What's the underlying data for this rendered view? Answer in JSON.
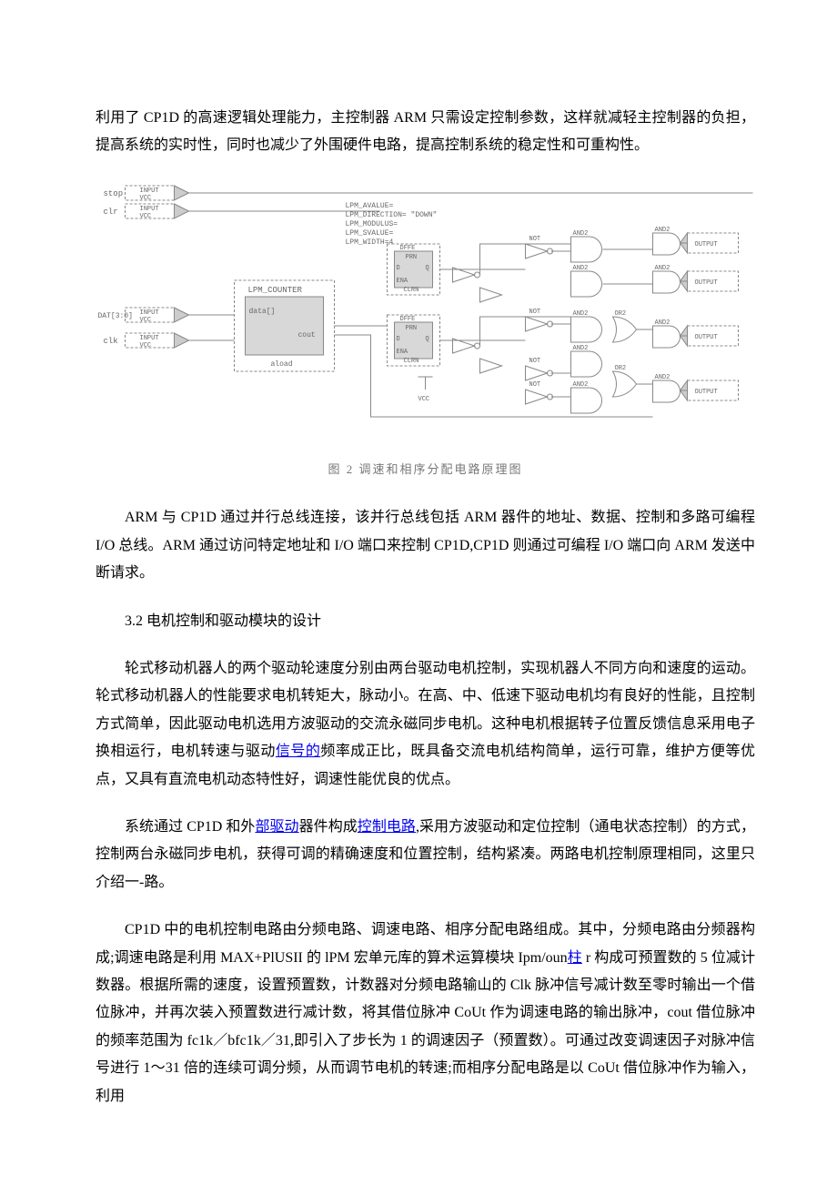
{
  "para1": "利用了 CP1D 的高速逻辑处理能力，主控制器 ARM 只需设定控制参数，这样就减轻主控制器的负担，提高系统的实时性，同时也减少了外围硬件电路，提高控制系统的稳定性和可重构性。",
  "figure": {
    "caption": "图 2  调速和相序分配电路原理图",
    "labels": {
      "stop": "stop",
      "clr": "clr",
      "data": "DAT[3:0]",
      "clk": "clk",
      "input": "INPUT",
      "vcc": "VCC",
      "lpm_counter": "LPM_COUNTER",
      "data_port": "data[]",
      "cout": "cout",
      "aload": "aload",
      "lpm_avalue": "LPM_AVALUE=",
      "lpm_direction": "LPM_DIRECTION= \"DOWN\"",
      "lpm_modulus": "LPM_MODULUS=",
      "lpm_svalue": "LPM_SVALUE=",
      "lpm_width": "LPM_WIDTH=4",
      "dffe": "DFFE",
      "prn": "PRN",
      "d": "D",
      "q": "Q",
      "ena": "ENA",
      "clrn": "CLRN",
      "not": "NOT",
      "and2": "AND2",
      "or2": "OR2",
      "output": "OUTPUT"
    }
  },
  "para2": "ARM 与 CP1D 通过并行总线连接，该并行总线包括 ARM 器件的地址、数据、控制和多路可编程 I/O 总线。ARM 通过访问特定地址和 I/O 端口来控制 CP1D,CP1D 则通过可编程 I/O 端口向 ARM 发送中断请求。",
  "section": "3.2 电机控制和驱动模块的设计",
  "para3_a": "轮式移动机器人的两个驱动轮速度分别由两台驱动电机控制，实现机器人不同方向和速度的运动。轮式移动机器人的性能要求电机转矩大，脉动小。在高、中、低速下驱动电机均有良好的性能，且控制方式简单，因此驱动电机选用方波驱动的交流永磁同步电机。这种电机根据转子位置反馈信息采用电子换相运行，电机转速与驱动",
  "para3_link1": "信号的",
  "para3_b": "频率成正比，既具备交流电机结构简单，运行可靠，维护方便等优点，又具有直流电机动态特性好，调速性能优良的优点。",
  "para4_a": "系统通过 CP1D 和外",
  "para4_link1": "部驱动",
  "para4_b": "器件构成",
  "para4_link2": "控制电路",
  "para4_c": ",采用方波驱动和定位控制（通电状态控制）的方式，控制两台永磁同步电机，获得可调的精确速度和位置控制，结构紧凑。两路电机控制原理相同，这里只介绍一-路。",
  "para5_a": "CP1D 中的电机控制电路由分频电路、调速电路、相序分配电路组成。其中，分频电路由分频器构成;调速电路是利用 MAX+PlUSII 的 lPM 宏单元库的算术运算模块 Ipm/oun",
  "para5_link1": "柱",
  "para5_b": " r 构成可预置数的 5 位减计数器。根据所需的速度，设置预置数，计数器对分频电路输山的 Clk 脉冲信号减计数至零时输出一个借位脉冲，并再次装入预置数进行减计数，将其借位脉冲 CoUt 作为调速电路的输出脉冲，cout 借位脉冲的频率范围为 fc1k／bfc1k／31,即引入了步长为 1 的调速因子（预置数）。可通过改变调速因子对脉冲信号进行 1～31 倍的连续可调分频，从而调节电机的转速;而相序分配电路是以 CoUt 借位脉冲作为输入，利用"
}
